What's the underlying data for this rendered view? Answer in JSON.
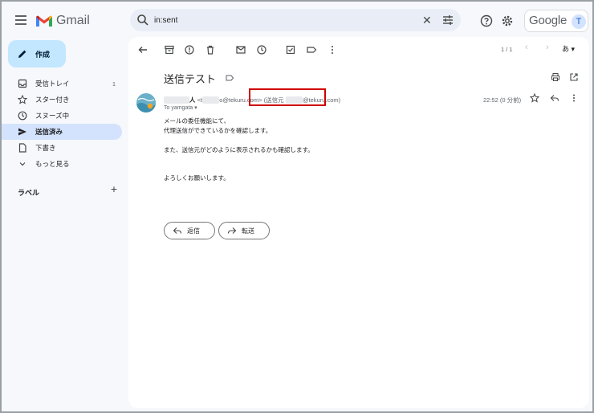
{
  "app": {
    "name": "Gmail"
  },
  "search": {
    "value": "in:sent"
  },
  "account": {
    "brand": "Google",
    "avatar_letter": "T"
  },
  "compose": {
    "label": "作成"
  },
  "nav": [
    {
      "icon": "inbox-icon",
      "label": "受信トレイ",
      "count": "1"
    },
    {
      "icon": "star-icon",
      "label": "スター付き",
      "count": ""
    },
    {
      "icon": "clock-icon",
      "label": "スヌーズ中",
      "count": ""
    },
    {
      "icon": "send-icon",
      "label": "送信済み",
      "count": "",
      "active": true
    },
    {
      "icon": "draft-icon",
      "label": "下書き",
      "count": ""
    },
    {
      "icon": "chevron-down-icon",
      "label": "もっと見る",
      "count": ""
    }
  ],
  "labels": {
    "heading": "ラベル"
  },
  "toolbar": {
    "pager": "1 / 1",
    "input_lang": "あ"
  },
  "email": {
    "subject": "送信テスト",
    "sender_name_start": "",
    "sender_name_end": "人",
    "sender_email_prefix": "<t",
    "sender_email_suffix": "o@tekuru.com>",
    "via_prefix": "(送信元",
    "via_suffix": "@tekuru.com)",
    "to": "To yamgata",
    "time": "22:52 (0 分前)",
    "body_line1": "メールの委任機能にて、",
    "body_line2": "代理送信ができているかを確認します。",
    "body_line3": "また、送信元がどのように表示されるかも確認します。",
    "body_line4": "よろしくお願いします。"
  },
  "actions": {
    "reply": "返信",
    "forward": "転送"
  },
  "colors": {
    "compose_bg": "#c2e7ff",
    "active_nav": "#d3e3fd",
    "highlight": "#d00000",
    "search_bg": "#e9eef6"
  }
}
